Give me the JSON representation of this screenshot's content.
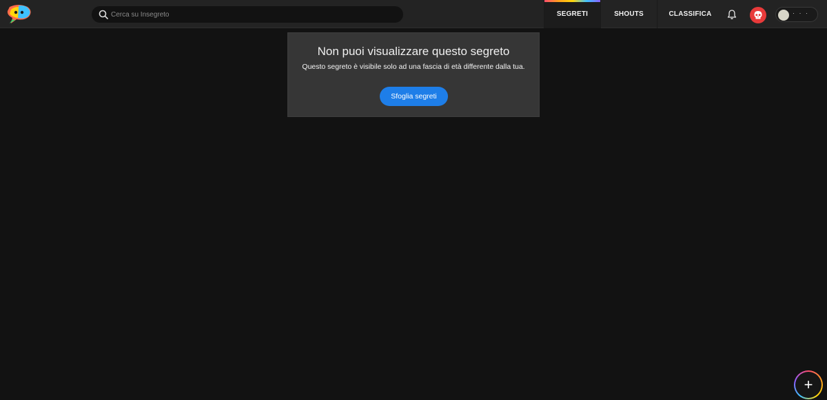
{
  "header": {
    "logo_icon": "speech-bubble-logo-icon",
    "search": {
      "placeholder": "Cerca su Insegreto",
      "value": ""
    },
    "tabs": [
      {
        "label": "SEGRETI",
        "active": true
      },
      {
        "label": "SHOUTS",
        "active": false
      },
      {
        "label": "CLASSIFICA",
        "active": false
      }
    ],
    "notifications_icon": "bell-icon",
    "avatar_icon": "skull-icon",
    "accent_gradient": [
      "#ff4d6d",
      "#ff9f1c",
      "#ffd60a",
      "#3ec1ff",
      "#8f5cff"
    ]
  },
  "notice": {
    "title": "Non puoi visualizzare questo segreto",
    "message": "Questo segreto è visibile solo ad una fascia di età differente dalla tua.",
    "button_label": "Sfoglia segreti",
    "button_color": "#1e7ee8"
  },
  "fab": {
    "label": "+",
    "icon": "plus-icon"
  },
  "colors": {
    "background": "#121212",
    "topbar": "#232323",
    "card": "#363636",
    "avatar": "#e83a3a"
  }
}
